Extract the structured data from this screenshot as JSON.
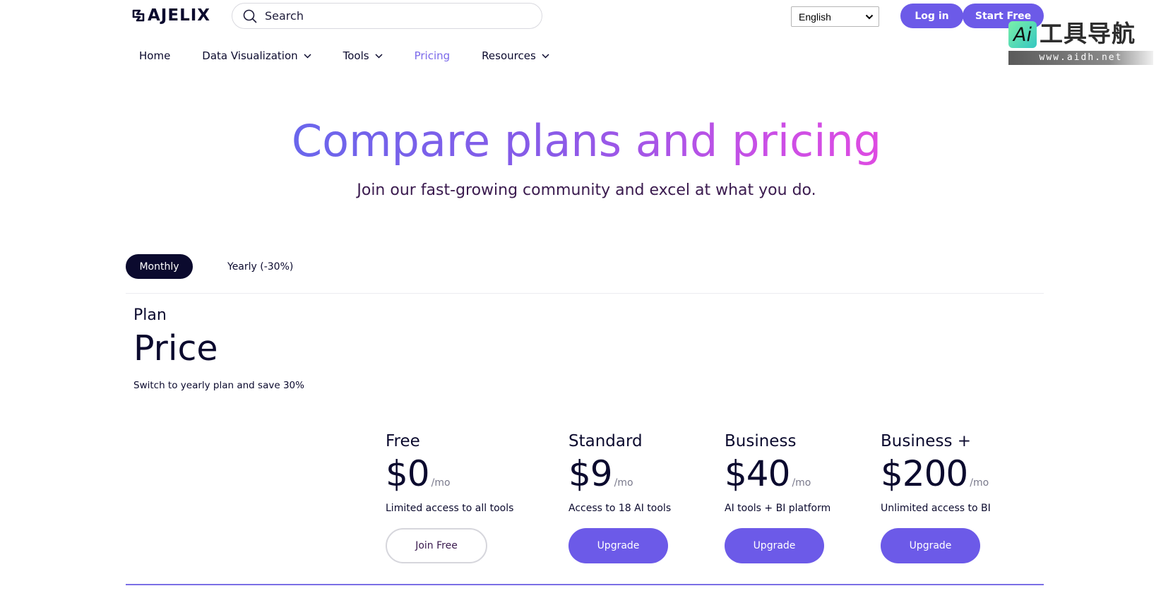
{
  "header": {
    "logo_text": "AJELIX",
    "search_placeholder": "Search",
    "language": "English",
    "login_label": "Log in",
    "start_label": "Start Free"
  },
  "watermark": {
    "ai": "Ai",
    "title": "工具导航",
    "url": "www.aidh.net"
  },
  "nav": {
    "home": "Home",
    "data_viz": "Data Visualization",
    "tools": "Tools",
    "pricing": "Pricing",
    "resources": "Resources"
  },
  "hero": {
    "title": "Compare plans and pricing",
    "subtitle": "Join our fast-growing community and excel at what you do."
  },
  "billing": {
    "monthly": "Monthly",
    "yearly": "Yearly (-30%)"
  },
  "table_header": {
    "plan": "Plan",
    "price": "Price",
    "note": "Switch to yearly plan and save 30%"
  },
  "plans": [
    {
      "name": "Free",
      "price": "$0",
      "period": "/mo",
      "desc": "Limited access to all tools",
      "cta": "Join Free"
    },
    {
      "name": "Standard",
      "price": "$9",
      "period": "/mo",
      "desc": "Access to 18 AI tools",
      "cta": "Upgrade"
    },
    {
      "name": "Business",
      "price": "$40",
      "period": "/mo",
      "desc": "AI tools + BI platform",
      "cta": "Upgrade"
    },
    {
      "name": "Business +",
      "price": "$200",
      "period": "/mo",
      "desc": "Unlimited access to BI",
      "cta": "Upgrade"
    }
  ],
  "colors": {
    "primary": "#6c5ae8",
    "dark": "#0b0a2e",
    "active_nav": "#7b69ea"
  }
}
